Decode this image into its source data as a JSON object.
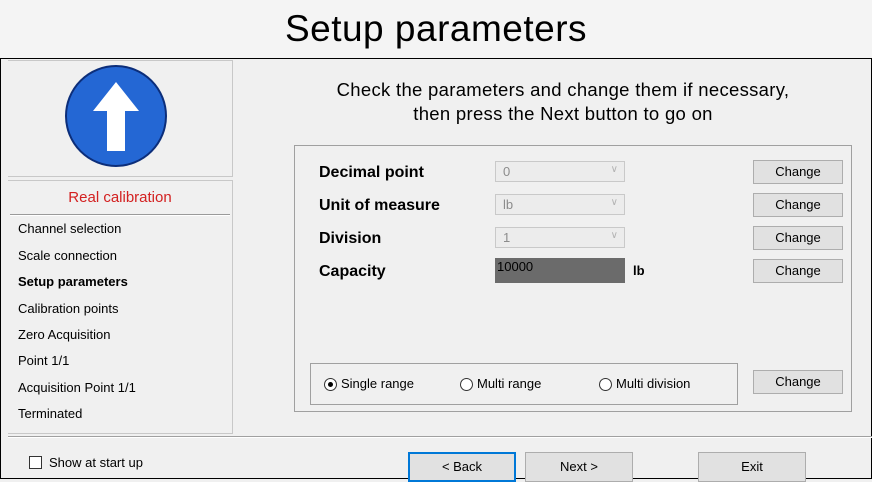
{
  "header": {
    "title": "Setup parameters"
  },
  "sidebar": {
    "icon": "up-arrow-icon",
    "steps_title": "Real calibration",
    "steps": [
      "Channel selection",
      "Scale connection",
      "Setup parameters",
      "Calibration points",
      "Zero Acquisition",
      "Point 1/1",
      "Acquisition Point 1/1",
      "Terminated"
    ],
    "active_step": "Setup parameters"
  },
  "main": {
    "instruction_line1": "Check the parameters and change them if necessary,",
    "instruction_line2": "then press the Next button to go on",
    "params": {
      "decimal_point": {
        "label": "Decimal point",
        "value": "0",
        "change": "Change"
      },
      "unit_of_measure": {
        "label": "Unit of measure",
        "value": "lb",
        "change": "Change"
      },
      "division": {
        "label": "Division",
        "value": "1",
        "change": "Change"
      },
      "capacity": {
        "label": "Capacity",
        "value": "10000",
        "unit": "lb",
        "change": "Change"
      }
    },
    "range": {
      "options": [
        "Single range",
        "Multi range",
        "Multi division"
      ],
      "selected": "Single range",
      "change": "Change"
    }
  },
  "footer": {
    "show_at_startup": "Show at start up",
    "show_at_startup_checked": false,
    "back": "< Back",
    "next": "Next >",
    "exit": "Exit"
  },
  "colors": {
    "accent_blue": "#2467d4",
    "step_title": "#d32020",
    "capacity_bg": "#6b6b6b",
    "default_button_border": "#0078d7"
  }
}
